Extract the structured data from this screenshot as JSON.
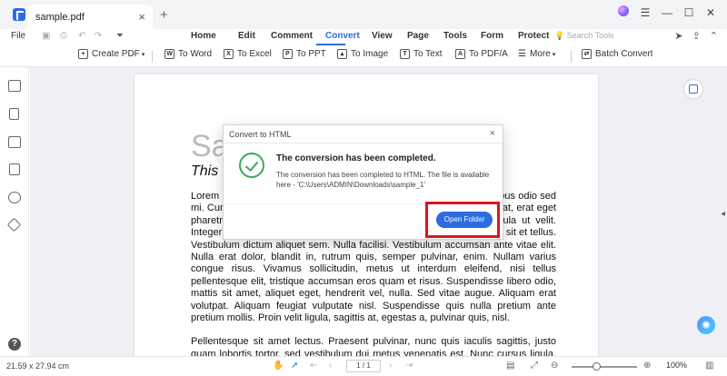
{
  "window": {
    "tab_title": "sample.pdf",
    "tab_close": "×",
    "tab_add": "+"
  },
  "menubar": {
    "file": "File",
    "tabs": [
      "Home",
      "Edit",
      "Comment",
      "Convert",
      "View",
      "Page",
      "Tools",
      "Form",
      "Protect"
    ],
    "active_tab": "Convert",
    "search_placeholder": "Search Tools"
  },
  "toolbar": {
    "create_pdf": "Create PDF",
    "to_word": "To Word",
    "to_excel": "To Excel",
    "to_ppt": "To PPT",
    "to_image": "To Image",
    "to_text": "To Text",
    "to_pdfa": "To PDF/A",
    "more": "More",
    "batch_convert": "Batch Convert"
  },
  "document": {
    "title_partial": "Sa",
    "subtitle_partial": "This is",
    "paragraph1": "Lorem ipsum dolor sit amet, consectetur adipiscing elit. Nunc ac faucibus odio sed mi. Curabitur ut ligula sit amet erat efficitur eleifend. Donec id lorem erat, erat eget pharetra. Nulla bibendum, purus eget vehicula accumsan, ante ligula ut velit. Integer consectetur erat lorem, ac interdum velit vestibulum ac. Integer sit et tellus. Vestibulum dictum aliquet sem. Nulla facilisi. Vestibulum accumsan ante vitae elit. Nulla erat dolor, blandit in, rutrum quis, semper pulvinar, enim. Nullam varius congue risus. Vivamus sollicitudin, metus ut interdum eleifend, nisi tellus pellentesque elit, tristique accumsan eros quam et risus. Suspendisse libero odio, mattis sit amet, aliquet eget, hendrerit vel, nulla. Sed vitae augue. Aliquam erat volutpat. Aliquam feugiat vulputate nisl. Suspendisse quis nulla pretium ante pretium mollis. Proin velit ligula, sagittis at, egestas a, pulvinar quis, nisl.",
    "paragraph2": "Pellentesque sit amet lectus. Praesent pulvinar, nunc quis iaculis sagittis, justo quam lobortis tortor, sed vestibulum dui metus venenatis est. Nunc cursus ligula. Mauris facilisis."
  },
  "dialog": {
    "title": "Convert to HTML",
    "close": "×",
    "heading": "The conversion has been completed.",
    "message": "The conversion has been completed to HTML. The file is available here - 'C:\\Users\\ADMIN\\Downloads\\sample_1'",
    "button": "Open Folder"
  },
  "statusbar": {
    "dimensions": "21.59 x 27.94 cm",
    "page": "1 / 1",
    "zoom": "100%"
  },
  "colors": {
    "accent": "#2d6cdf",
    "success": "#3aaa5c",
    "highlight": "#e0141b"
  }
}
